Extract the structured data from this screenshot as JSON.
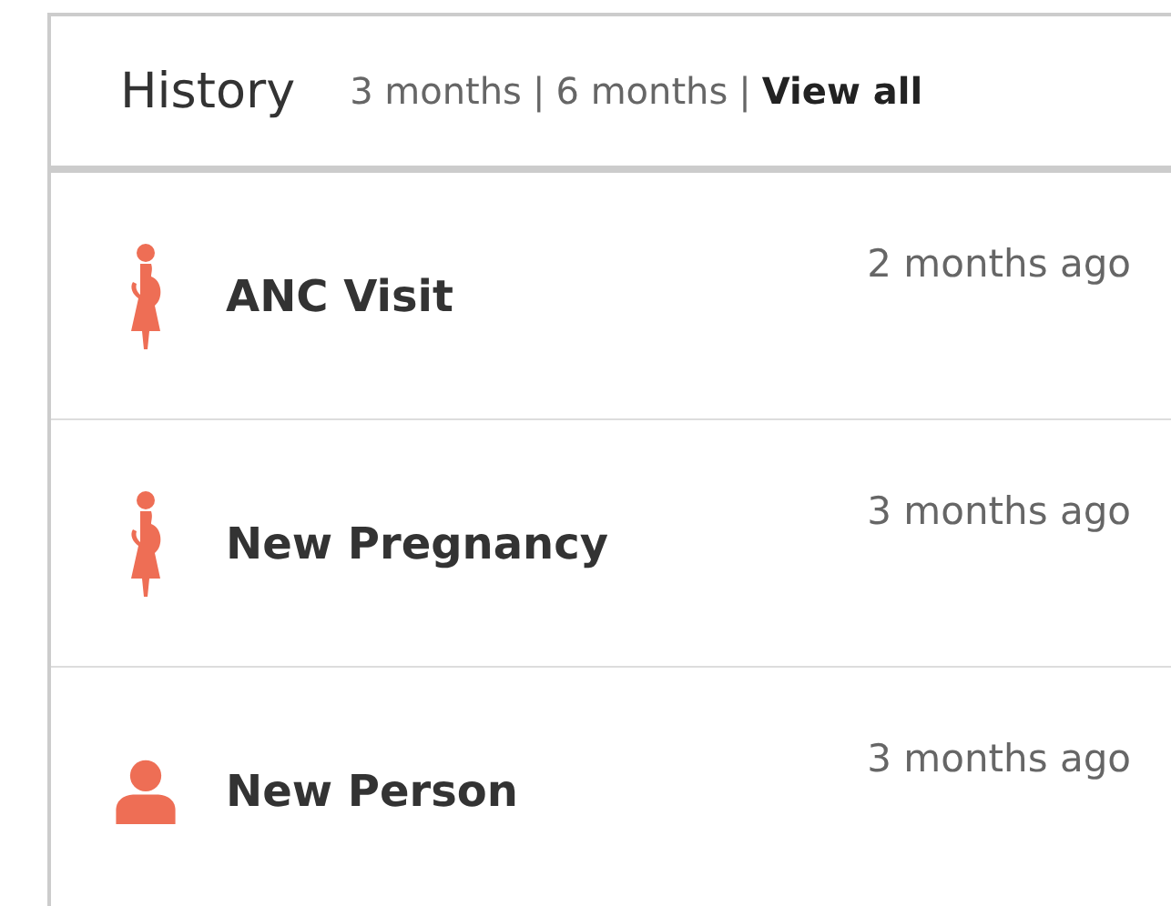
{
  "header": {
    "title": "History",
    "filters": [
      {
        "label": "3 months",
        "selected": false
      },
      {
        "label": "6 months",
        "selected": false
      },
      {
        "label": "View all",
        "selected": true
      }
    ],
    "separator": "|"
  },
  "items": [
    {
      "kind": "pregnancy",
      "title": "ANC Visit",
      "time": "2 months ago"
    },
    {
      "kind": "pregnancy",
      "title": "New Pregnancy",
      "time": "3 months ago"
    },
    {
      "kind": "person",
      "title": "New Person",
      "time": "3 months ago"
    }
  ]
}
